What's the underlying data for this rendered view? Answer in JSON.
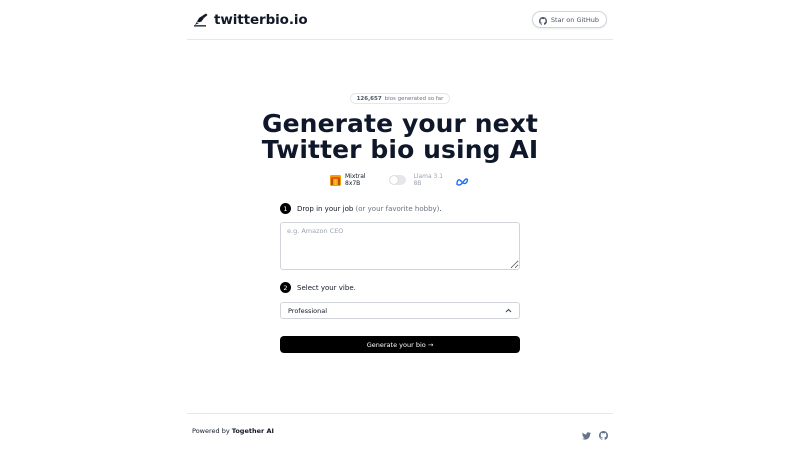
{
  "header": {
    "brand": "twitterbio.io",
    "github_button": "Star on GitHub"
  },
  "counter": {
    "count": "126,657",
    "suffix": "bios generated so far"
  },
  "hero": {
    "title_line1": "Generate your next",
    "title_line2": "Twitter bio using AI"
  },
  "models": {
    "left": "Mixtral 8x7B",
    "right": "Llama 3.1 8B",
    "selected": "Mixtral 8x7B"
  },
  "step1": {
    "number": "1",
    "label": "Drop in your job",
    "hint": "(or your favorite hobby)",
    "suffix": ".",
    "placeholder": "e.g. Amazon CEO",
    "value": ""
  },
  "step2": {
    "number": "2",
    "label": "Select your vibe.",
    "selected": "Professional"
  },
  "generate_button": "Generate your bio →",
  "footer": {
    "powered_prefix": "Powered by",
    "powered_brand": "Together AI",
    "icons": [
      "twitter-icon",
      "github-icon"
    ]
  },
  "colors": {
    "primary": "#000000",
    "title": "#0f172a",
    "muted": "#6b7280",
    "border": "#e5e7eb"
  }
}
